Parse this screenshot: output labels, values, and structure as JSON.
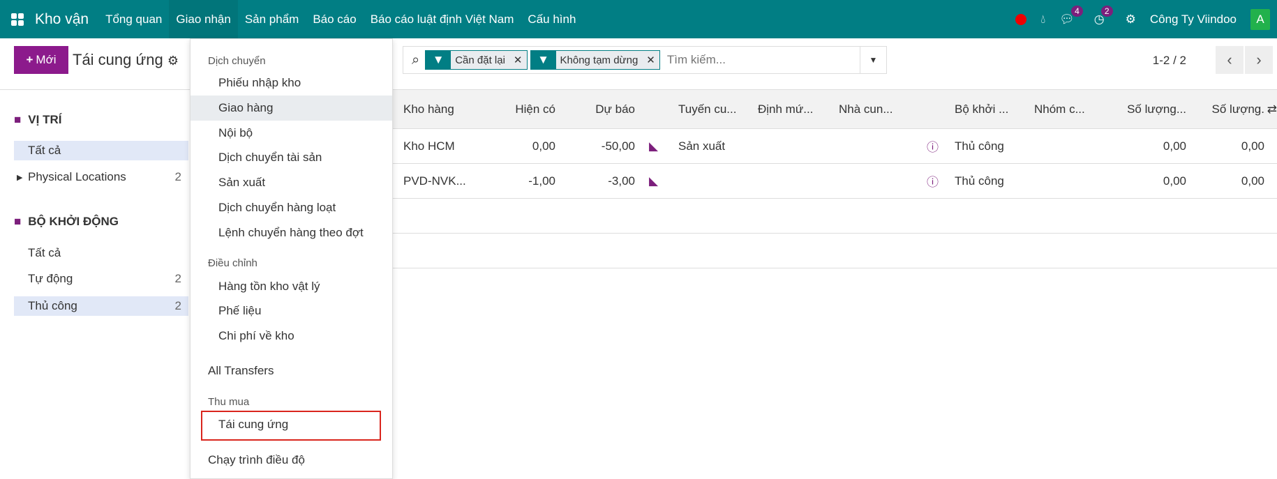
{
  "nav": {
    "app": "Kho vận",
    "menu": [
      "Tổng quan",
      "Giao nhận",
      "Sản phẩm",
      "Báo cáo",
      "Báo cáo luật định Việt Nam",
      "Cấu hình"
    ],
    "messages_count": "4",
    "activities_count": "2",
    "company": "Công Ty Viindoo",
    "avatar": "A"
  },
  "control": {
    "new_label": "Mới",
    "breadcrumb": "Tái cung ứng",
    "facets": [
      "Cần đặt lại",
      "Không tạm dừng"
    ],
    "search_placeholder": "Tìm kiếm...",
    "pager": "1-2 / 2"
  },
  "sidebar": {
    "groups": [
      {
        "title": "VỊ TRÍ",
        "items": [
          {
            "label": "Tất cả",
            "count": ""
          },
          {
            "label": "Physical Locations",
            "count": "2"
          }
        ]
      },
      {
        "title": "BỘ KHỞI ĐỘNG",
        "items": [
          {
            "label": "Tất cả",
            "count": ""
          },
          {
            "label": "Tự động",
            "count": "2"
          },
          {
            "label": "Thủ công",
            "count": "2"
          }
        ]
      }
    ]
  },
  "dropdown": {
    "h1": "Dịch chuyển",
    "items1": [
      "Phiếu nhập kho",
      "Giao hàng",
      "Nội bộ",
      "Dịch chuyển tài sản",
      "Sản xuất",
      "Dịch chuyển hàng loạt",
      "Lệnh chuyển hàng theo đợt"
    ],
    "h2": "Điều chỉnh",
    "items2": [
      "Hàng tồn kho vật lý",
      "Phế liệu",
      "Chi phí về kho"
    ],
    "all": "All Transfers",
    "h3": "Thu mua",
    "items3": [
      "Tái cung ứng"
    ],
    "run": "Chạy trình điều độ"
  },
  "table": {
    "headers": [
      "Kho hàng",
      "Hiện có",
      "Dự báo",
      "Tuyến cu...",
      "Định mứ...",
      "Nhà cun...",
      "Bộ khởi ...",
      "Nhóm c...",
      "Số lượng...",
      "Số lượng."
    ],
    "rows": [
      [
        "Kho HCM",
        "0,00",
        "-50,00",
        "Sản xuất",
        "",
        "",
        "Thủ công",
        "",
        "0,00",
        "0,00"
      ],
      [
        "PVD-NVK...",
        "-1,00",
        "-3,00",
        "",
        "",
        "",
        "Thủ công",
        "",
        "0,00",
        "0,00"
      ]
    ]
  }
}
